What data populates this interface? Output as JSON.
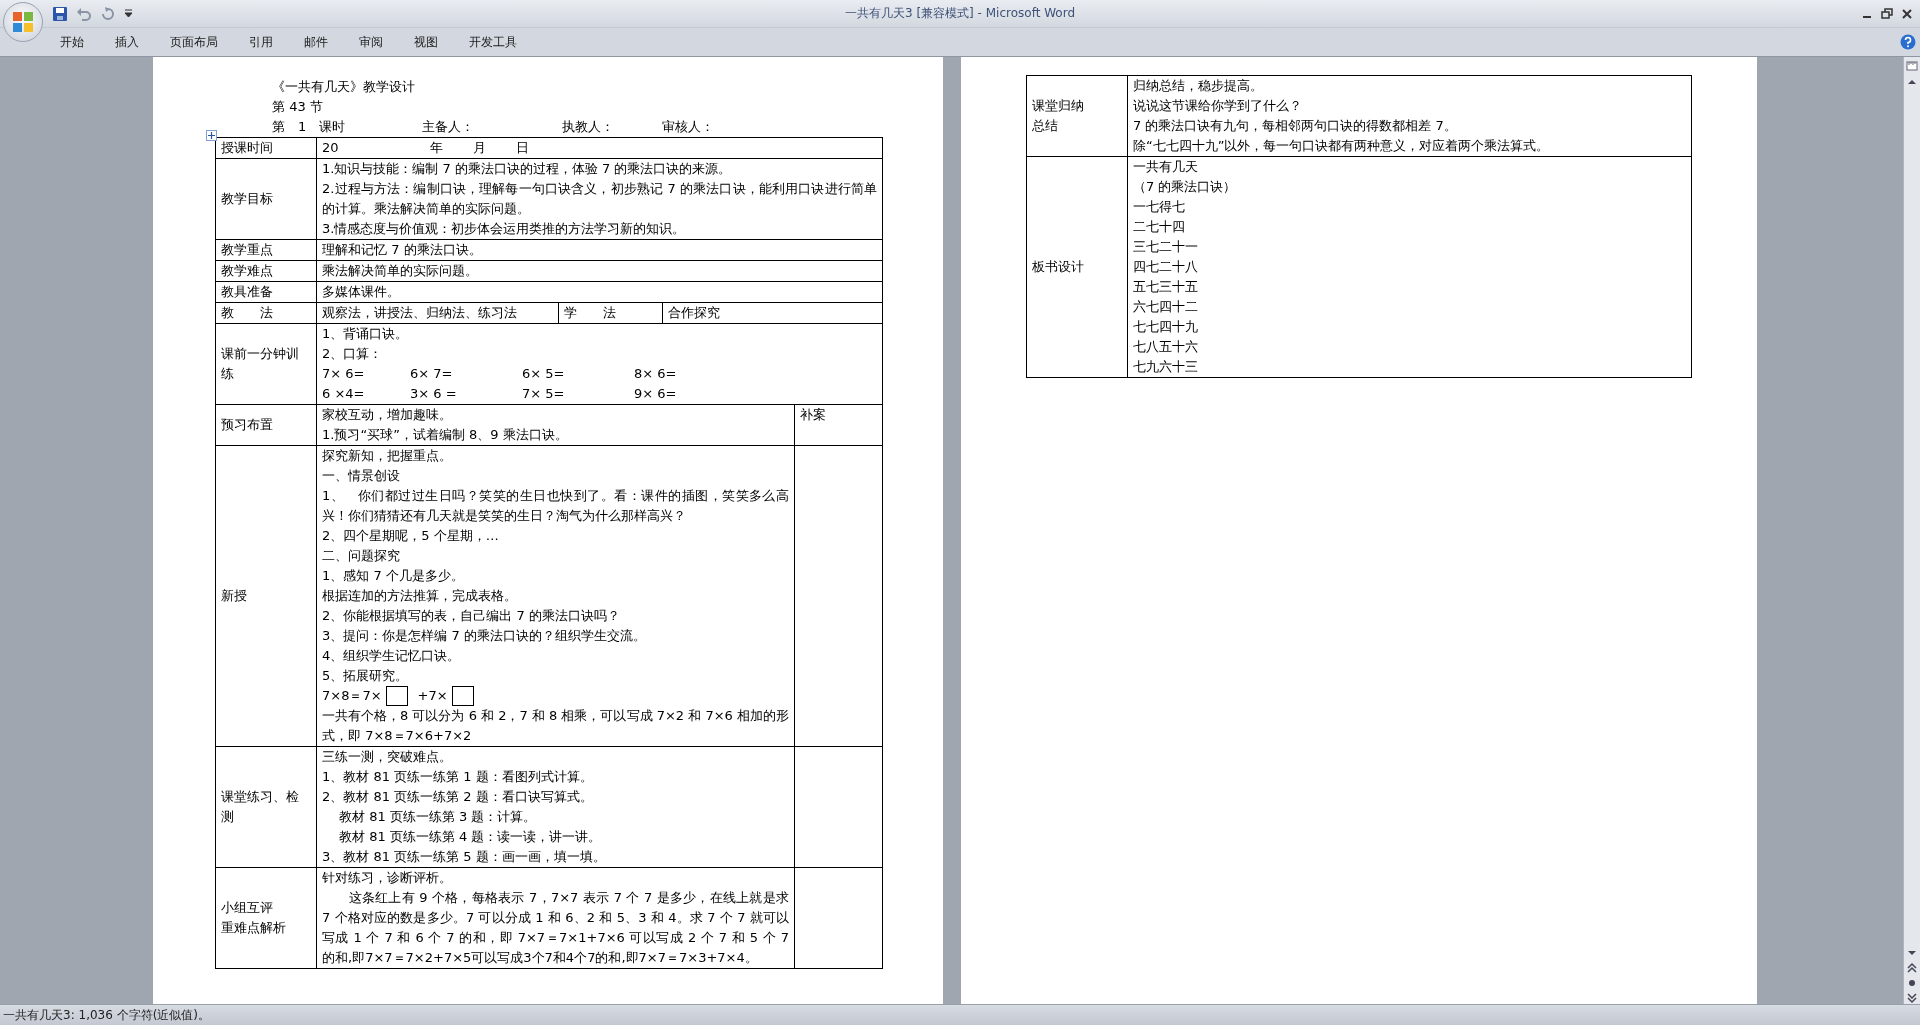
{
  "window": {
    "title": "一共有几天3 [兼容模式] - Microsoft Word"
  },
  "ribbon_tabs": [
    "开始",
    "插入",
    "页面布局",
    "引用",
    "邮件",
    "审阅",
    "视图",
    "开发工具"
  ],
  "document": {
    "heading": "《一共有几天》教学设计",
    "section": "第 43 节",
    "meta": [
      "第　1　课时",
      "主备人：",
      "执教人：",
      "审核人："
    ],
    "lesson_table": [
      {
        "kind": "text",
        "label": [
          "授课时间"
        ],
        "lines": [
          "20　　　　　　　年　　 月　　 日"
        ]
      },
      {
        "kind": "text",
        "label": [
          "教学目标"
        ],
        "lines": [
          "1.知识与技能：编制 7 的乘法口诀的过程，体验 7 的乘法口诀的来源。",
          "2.过程与方法：编制口诀，理解每一句口诀含义，初步熟记 7 的乘法口诀，能利用口诀进行简单的计算。乘法解决简单的实际问题。",
          "3.情感态度与价值观：初步体会运用类推的方法学习新的知识。"
        ]
      },
      {
        "kind": "text",
        "label": [
          "教学重点"
        ],
        "lines": [
          "理解和记忆 7 的乘法口诀。"
        ]
      },
      {
        "kind": "text",
        "label": [
          "教学难点"
        ],
        "lines": [
          "乘法解决简单的实际问题。"
        ]
      },
      {
        "kind": "text",
        "label": [
          "教具准备"
        ],
        "lines": [
          "多媒体课件。"
        ]
      },
      {
        "kind": "methods",
        "label": [
          "教　　法"
        ],
        "teach": "观察法，讲授法、归纳法、练习法",
        "learn_label": "学　　法",
        "learn": "合作探究"
      },
      {
        "kind": "drill",
        "label": [
          "课前一分钟训练"
        ],
        "lines": [
          "1、背诵口诀。",
          "2、口算："
        ],
        "grid": [
          [
            "7× 6=",
            "6× 7=",
            "6× 5=",
            "8× 6="
          ],
          [
            "6 ×4=",
            "3× 6 =",
            "7× 5=",
            "9× 6="
          ]
        ]
      },
      {
        "kind": "notes",
        "label": [
          "预习布置"
        ],
        "lines": [
          "家校互动，增加趣味。",
          "1.预习“买球”，试着编制 8、9 乘法口诀。"
        ],
        "side": "补案"
      },
      {
        "kind": "notes",
        "label": [
          "新授"
        ],
        "lines": [
          "探究新知，把握重点。",
          "一、情景创设",
          "1、　你们都过过生日吗？笑笑的生日也快到了。看：课件的插图，笑笑多么高兴！你们猜猜还有几天就是笑笑的生日？淘气为什么那样高兴？",
          "2、四个星期呢，5 个星期，…",
          "二、问题探究",
          "1、感知 7 个几是多少。",
          "根据连加的方法推算，完成表格。",
          "2、你能根据填写的表，自己编出 7 的乘法口诀吗？",
          "3、提问：你是怎样编 7 的乘法口诀的？组织学生交流。",
          "4、组织学生记忆口诀。",
          "5、拓展研究。",
          {
            "kind": "blanks",
            "parts": [
              "7×8＝7×",
              "+7×"
            ]
          },
          "一共有个格，8 可以分为 6 和 2，7 和 8 相乘，可以写成 7×2 和 7×6 相加的形式，即 7×8＝7×6+7×2"
        ]
      },
      {
        "kind": "notes",
        "label": [
          "课堂练习、检测"
        ],
        "lines": [
          "三练一测，突破难点。",
          "1、教材 81 页练一练第 1 题：看图列式计算。",
          "2、教材 81 页练一练第 2 题：看口诀写算式。",
          "　 教材 81 页练一练第 3 题：计算。",
          "　 教材 81 页练一练第 4 题：读一读，讲一讲。",
          "3、教材 81 页练一练第 5 题：画一画，填一填。"
        ]
      },
      {
        "kind": "notes",
        "label": [
          "小组互评",
          "重难点解析"
        ],
        "lines": [
          "针对练习，诊断评析。",
          "　　这条红上有 9 个格，每格表示 7，7×7 表示 7 个 7 是多少，在线上就是求 7 个格对应的数是多少。7 可以分成 1 和 6、2 和 5、3 和 4。求 7 个 7 就可以写成 1 个 7 和 6 个 7 的和，即 7×7＝7×1+7×6 可以写成 2 个 7 和 5 个 7 的和,即7×7＝7×2+7×5可以写成3个7和4个7的和,即7×7＝7×3+7×4。"
        ]
      }
    ],
    "summary_table": [
      {
        "kind": "text",
        "label": [
          "课堂归纳",
          "总结"
        ],
        "lines": [
          "归纳总结，稳步提高。",
          "说说这节课给你学到了什么？",
          "7 的乘法口诀有九句，每相邻两句口诀的得数都相差 7。",
          "除“七七四十九”以外，每一句口诀都有两种意义，对应着两个乘法算式。"
        ]
      },
      {
        "kind": "text",
        "label": [
          "板书设计"
        ],
        "lines": [
          "一共有几天",
          "（7 的乘法口诀）",
          "一七得七",
          "二七十四",
          "三七二十一",
          "四七二十八",
          "五七三十五",
          "六七四十二",
          "七七四十九",
          "七八五十六",
          "七九六十三"
        ]
      }
    ]
  },
  "status_bar": "一共有几天3: 1,036 个字符(近似值)。"
}
